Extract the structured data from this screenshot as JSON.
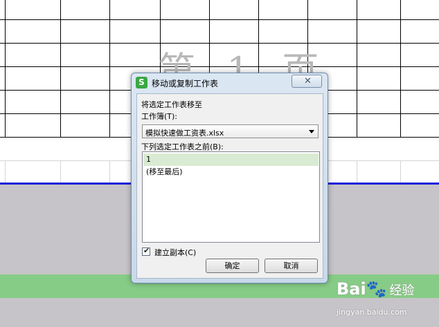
{
  "sheet": {
    "watermark": "第 1 页"
  },
  "dialog": {
    "app_icon": "S",
    "title": "移动或复制工作表",
    "close_glyph": "✕",
    "move_to_label": "将选定工作表移至",
    "workbook_label": "工作簿(T):",
    "workbook_value": "模拟快速做工资表.xlsx",
    "before_sheet_label": "下列选定工作表之前(B):",
    "sheet_list": [
      "1",
      "(移至最后)"
    ],
    "selected_index": 0,
    "copy_checked": true,
    "copy_label": "建立副本(C)",
    "ok_label": "确定",
    "cancel_label": "取消"
  },
  "watermark": {
    "logo_text": "Bai🐾",
    "logo_suffix": "经验",
    "url": "jingyan.baidu.com"
  },
  "colors": {
    "page_break": "#1a1adc",
    "gray_area": "#c6c4c8",
    "green_strip": "#86cc86",
    "app_icon_green": "#3aa843"
  }
}
